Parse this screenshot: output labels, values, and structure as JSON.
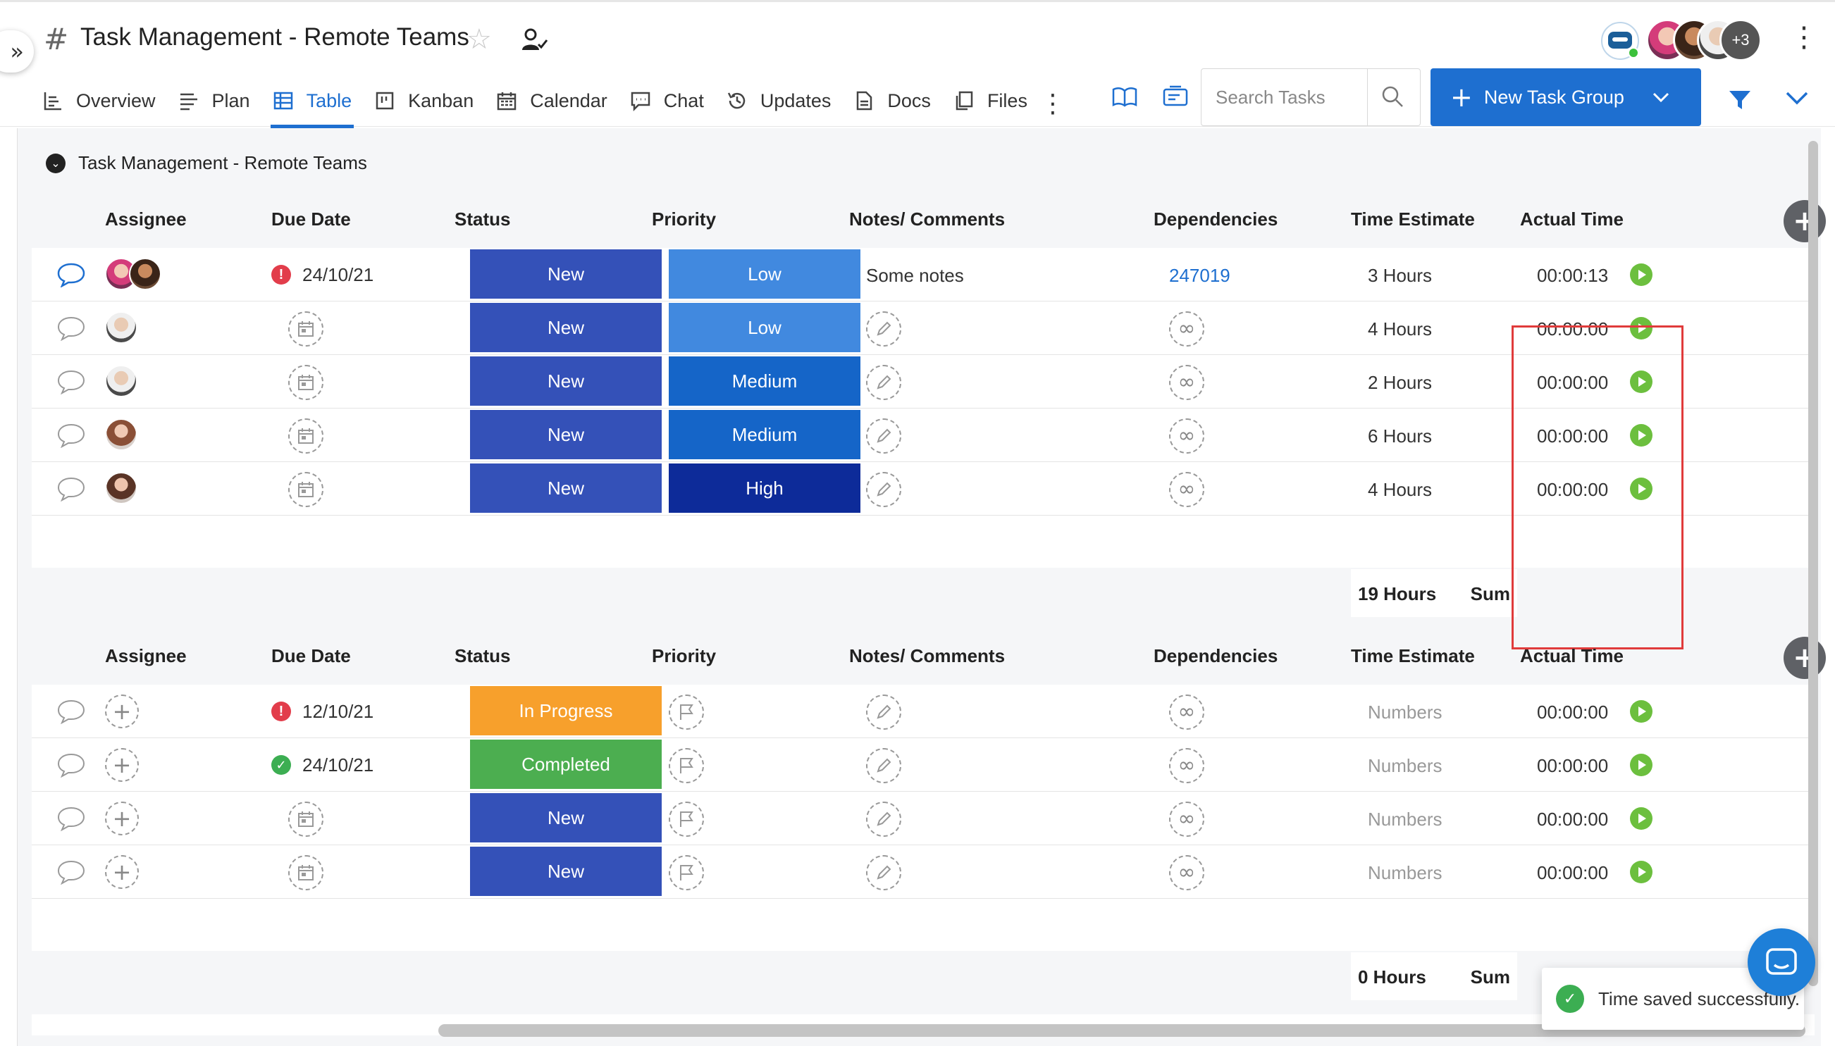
{
  "header": {
    "title": "Task Management - Remote Teams",
    "more_members": "+3"
  },
  "tabs": [
    {
      "label": "Overview",
      "icon": "overview-icon"
    },
    {
      "label": "Plan",
      "icon": "plan-icon"
    },
    {
      "label": "Table",
      "icon": "table-icon",
      "active": true
    },
    {
      "label": "Kanban",
      "icon": "kanban-icon"
    },
    {
      "label": "Calendar",
      "icon": "calendar-icon"
    },
    {
      "label": "Chat",
      "icon": "chat-icon"
    },
    {
      "label": "Updates",
      "icon": "history-icon"
    },
    {
      "label": "Docs",
      "icon": "doc-icon"
    },
    {
      "label": "Files",
      "icon": "files-icon"
    }
  ],
  "search": {
    "placeholder": "Search Tasks"
  },
  "new_group_button": "New Task Group",
  "group1": {
    "name": "Task Management - Remote Teams",
    "columns": [
      "Assignee",
      "Due Date",
      "Status",
      "Priority",
      "Notes/ Comments",
      "Dependencies",
      "Time Estimate",
      "Actual Time"
    ],
    "rows": [
      {
        "due": "24/10/21",
        "status": "New",
        "priority": "Low",
        "notes": "Some notes",
        "dependency": "247019",
        "estimate": "3 Hours",
        "actual": "00:00:13"
      },
      {
        "due": "",
        "status": "New",
        "priority": "Low",
        "notes": "",
        "dependency": "",
        "estimate": "4 Hours",
        "actual": "00:00:00"
      },
      {
        "due": "",
        "status": "New",
        "priority": "Medium",
        "notes": "",
        "dependency": "",
        "estimate": "2 Hours",
        "actual": "00:00:00"
      },
      {
        "due": "",
        "status": "New",
        "priority": "Medium",
        "notes": "",
        "dependency": "",
        "estimate": "6 Hours",
        "actual": "00:00:00"
      },
      {
        "due": "",
        "status": "New",
        "priority": "High",
        "notes": "",
        "dependency": "",
        "estimate": "4 Hours",
        "actual": "00:00:00"
      }
    ],
    "sum_value": "19 Hours",
    "sum_label": "Sum"
  },
  "group2": {
    "columns": [
      "Assignee",
      "Due Date",
      "Status",
      "Priority",
      "Notes/ Comments",
      "Dependencies",
      "Time Estimate",
      "Actual Time"
    ],
    "rows": [
      {
        "due": "12/10/21",
        "status": "In Progress",
        "estimate": "Numbers",
        "actual": "00:00:00"
      },
      {
        "due": "24/10/21",
        "status": "Completed",
        "estimate": "Numbers",
        "actual": "00:00:00"
      },
      {
        "due": "",
        "status": "New",
        "estimate": "Numbers",
        "actual": "00:00:00"
      },
      {
        "due": "",
        "status": "New",
        "estimate": "Numbers",
        "actual": "00:00:00"
      }
    ],
    "sum_value": "0 Hours",
    "sum_label": "Sum"
  },
  "toast": "Time saved successfully.",
  "colors": {
    "accent": "#1e6fd0",
    "status_new": "#3451b8",
    "status_in_progress": "#f7a02c",
    "status_completed": "#4cae50",
    "priority_low": "#4189df",
    "priority_medium": "#1565c8",
    "priority_high": "#0d2b99",
    "highlight": "#e03b3b"
  }
}
